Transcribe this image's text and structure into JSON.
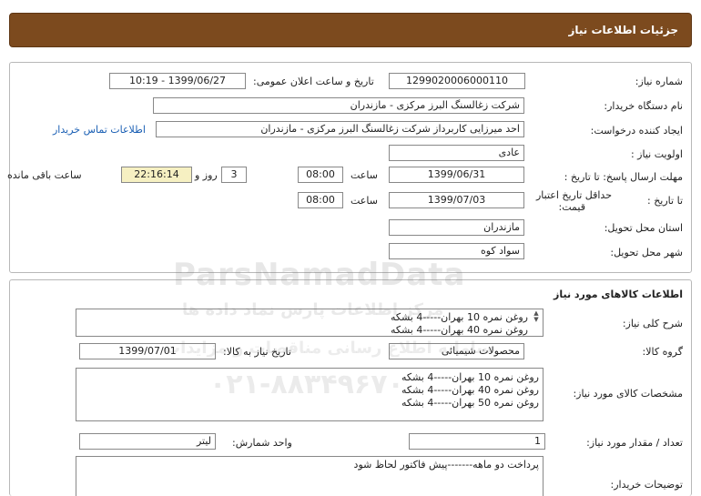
{
  "header": {
    "title": "جزئیات اطلاعات نیاز"
  },
  "info": {
    "need_number_label": "شماره نیاز:",
    "need_number": "1299020006000110",
    "announce_label": "تاریخ و ساعت اعلان عمومی:",
    "announce_value": "1399/06/27 - 10:19",
    "buyer_org_label": "نام دستگاه خریدار:",
    "buyer_org": "شرکت زغالسنگ البرز مرکزی - مازندران",
    "requester_label": "ایجاد کننده درخواست:",
    "requester": "احد میرزایی کاربرداز شرکت زغالسنگ البرز مرکزی - مازندران",
    "contact_link": "اطلاعات تماس خریدار",
    "priority_label": "اولویت نیاز :",
    "priority": "عادی",
    "reply_deadline_label": "مهلت ارسال پاسخ: تا تاریخ :",
    "reply_date": "1399/06/31",
    "time_label": "ساعت",
    "reply_time": "08:00",
    "days_value": "3",
    "days_label": "روز و",
    "remaining_time": "22:16:14",
    "remaining_label": "ساعت باقی مانده",
    "validity_label_1": "حداقل تاریخ اعتبار",
    "validity_label_2": "قیمت:",
    "validity_to_label": "تا تاریخ :",
    "validity_date": "1399/07/03",
    "validity_time_label": "ساعت",
    "validity_time": "08:00",
    "province_label": "استان محل تحویل:",
    "province": "مازندران",
    "city_label": "شهر محل تحویل:",
    "city": "سواد کوه"
  },
  "goods": {
    "section_title": "اطلاعات کالاهای مورد نیاز",
    "summary_label": "شرح کلی نیاز:",
    "summary_lines": [
      "روغن نمره 10 بهران-----4 بشکه",
      "روغن نمره 40 بهران-----4 بشکه"
    ],
    "group_label": "گروه کالا:",
    "group": "محصولات شیمیائی",
    "need_date_label": "تاریخ نیاز به کالا:",
    "need_date": "1399/07/01",
    "specs_label": "مشخصات کالای مورد نیاز:",
    "specs_lines": [
      "روغن نمره 10 بهران-----4 بشکه",
      "روغن نمره 40 بهران-----4 بشکه",
      "روغن نمره 50 بهران-----4 بشکه"
    ],
    "qty_label": "تعداد / مقدار مورد نیاز:",
    "qty": "1",
    "unit_label": "واحد شمارش:",
    "unit": "لیتر",
    "buyer_notes_label": "توضیحات خریدار:",
    "buyer_notes": "پرداخت دو ماهه-------پیش فاکتور لحاظ شود"
  },
  "watermark": {
    "brand": "ParsNamadData",
    "line1": "مرکز اطلاعات پارس نماد داده ها",
    "line2": "سامانه اطلاع رسانی مناقصات و مزایدات",
    "phone": "۰۲۱-۸۸۳۴۹۶۷۰"
  }
}
